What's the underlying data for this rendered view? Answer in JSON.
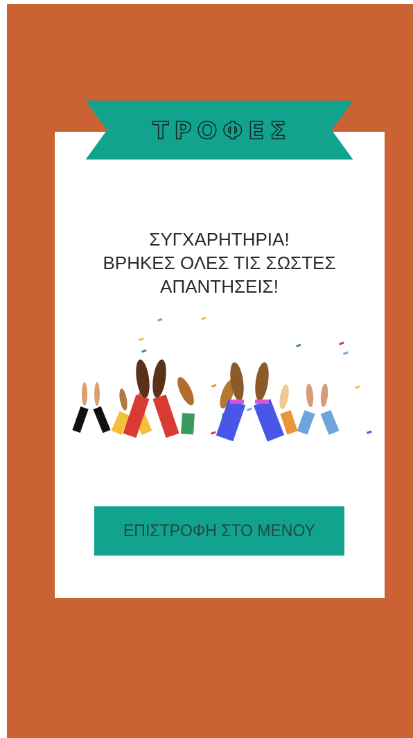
{
  "banner": {
    "title": "ΤΡΟΦΕΣ"
  },
  "message": {
    "lines": [
      "ΣΥΓΧΑΡΗΤΗΡΙΑ!",
      "ΒΡΗΚΕΣ ΟΛΕΣ ΤΙΣ ΣΩΣΤΕΣ",
      "ΑΠΑΝΤΗΣΕΙΣ!"
    ]
  },
  "button": {
    "label": "ΕΠΙΣΤΡΟΦΗ ΣΤΟ ΜΕΝΟΥ"
  }
}
